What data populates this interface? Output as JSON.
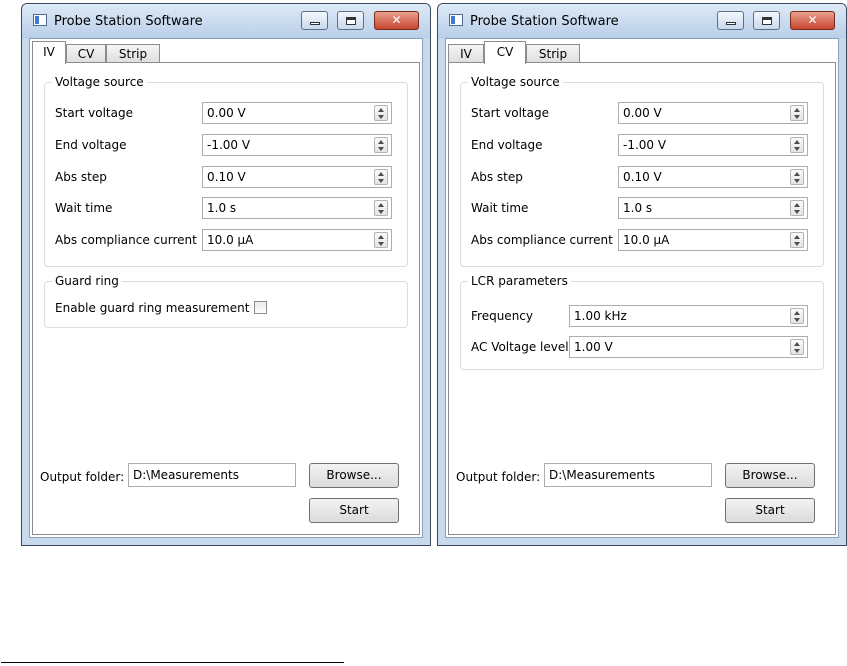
{
  "windows": [
    {
      "title": "Probe Station Software",
      "tabs": [
        "IV",
        "CV",
        "Strip"
      ],
      "active_tab": "IV",
      "voltage_source": {
        "title": "Voltage source",
        "rows": [
          {
            "label": "Start voltage",
            "value": "0.00 V"
          },
          {
            "label": "End voltage",
            "value": "-1.00 V"
          },
          {
            "label": "Abs step",
            "value": "0.10 V"
          },
          {
            "label": "Wait time",
            "value": "1.0 s"
          },
          {
            "label": "Abs compliance current",
            "value": "10.0 µA"
          }
        ]
      },
      "guard_ring": {
        "title": "Guard ring",
        "checkbox_label": "Enable guard ring measurement",
        "checked": false
      },
      "output_folder": {
        "label": "Output folder:",
        "value": "D:\\Measurements",
        "browse_label": "Browse..."
      },
      "start_label": "Start"
    },
    {
      "title": "Probe Station Software",
      "tabs": [
        "IV",
        "CV",
        "Strip"
      ],
      "active_tab": "CV",
      "voltage_source": {
        "title": "Voltage source",
        "rows": [
          {
            "label": "Start voltage",
            "value": "0.00 V"
          },
          {
            "label": "End voltage",
            "value": "-1.00 V"
          },
          {
            "label": "Abs step",
            "value": "0.10 V"
          },
          {
            "label": "Wait time",
            "value": "1.0 s"
          },
          {
            "label": "Abs compliance current",
            "value": "10.0 µA"
          }
        ]
      },
      "lcr_parameters": {
        "title": "LCR parameters",
        "rows": [
          {
            "label": "Frequency",
            "value": "1.00 kHz"
          },
          {
            "label": "AC Voltage level",
            "value": "1.00 V"
          }
        ]
      },
      "output_folder": {
        "label": "Output folder:",
        "value": "D:\\Measurements",
        "browse_label": "Browse..."
      },
      "start_label": "Start"
    }
  ]
}
